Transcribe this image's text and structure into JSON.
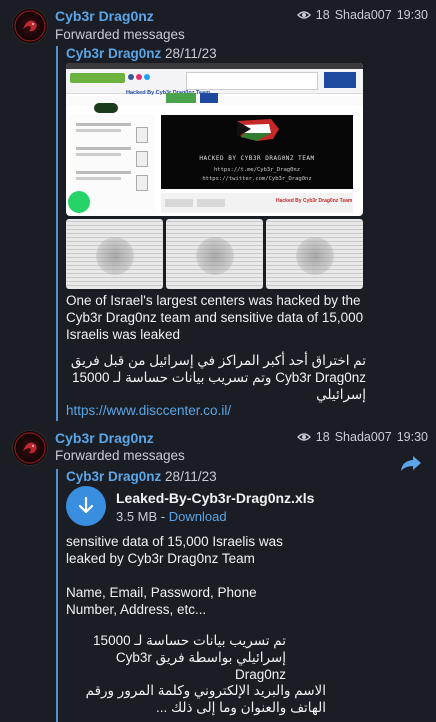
{
  "messages": [
    {
      "sender": "Cyb3r Drag0nz",
      "views": "18",
      "author": "Shada007",
      "time": "19:30",
      "forwarded_label": "Forwarded messages",
      "orig_author": "Cyb3r Drag0nz",
      "orig_date": "28/11/23",
      "preview": {
        "site_header": "Hacked By Cyb3r Drag0nz Team",
        "banner_lines": [
          "HACKED BY CYB3R DRAG0NZ TEAM",
          "https://t.me/Cyb3r_Drag0nz",
          "https://twitter.com/Cyb3r_Drag0nz"
        ],
        "footer_label": "Hacked By Cyb3r Drag0nz Team"
      },
      "text_en": "One of Israel's largest centers was hacked by the Cyb3r Drag0nz team and sensitive data of 15,000 Israelis was leaked",
      "text_ar": "تم اختراق أحد أكبر المراكز في إسرائيل من قبل فريق Cyb3r Drag0nz وتم تسريب بيانات حساسة لـ 15000 إسرائيلي",
      "link": "https://www.disccenter.co.il/"
    },
    {
      "sender": "Cyb3r Drag0nz",
      "views": "18",
      "author": "Shada007",
      "time": "19:30",
      "forwarded_label": "Forwarded messages",
      "orig_author": "Cyb3r Drag0nz",
      "orig_date": "28/11/23",
      "file_name": "Leaked-By-Cyb3r-Drag0nz.xls",
      "file_size": "3.5 MB",
      "file_sep": " - ",
      "download_label": "Download",
      "text_en_1": "sensitive data of 15,000 Israelis was leaked by Cyb3r Drag0nz Team",
      "text_en_2": "Name, Email, Password, Phone Number, Address, etc...",
      "text_ar_1": "تم تسريب بيانات حساسة لـ 15000 إسرائيلي بواسطة فريق Cyb3r Drag0nz",
      "text_ar_2": "الاسم والبريد الإلكتروني وكلمة المرور ورقم الهاتف والعنوان وما إلى ذلك ..."
    }
  ],
  "colors": {
    "accent": "#5aa6e8",
    "background": "#1b1d24",
    "quote_bar": "#4f8fd2"
  },
  "icons": [
    "eye-icon",
    "download-arrow-icon",
    "share-arrow-icon",
    "whatsapp-icon"
  ]
}
